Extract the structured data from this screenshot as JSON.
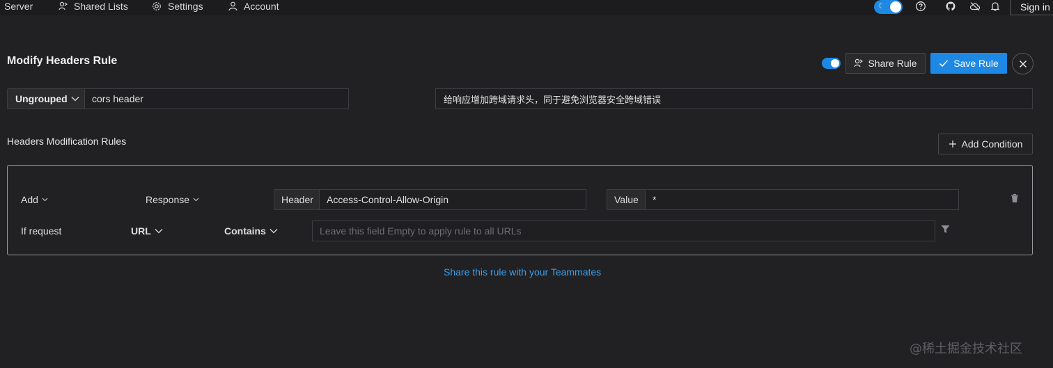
{
  "nav": {
    "server_label": "Server",
    "shared_lists_label": "Shared Lists",
    "settings_label": "Settings",
    "account_label": "Account",
    "sign_in_label": "Sign in"
  },
  "header": {
    "title": "Modify Headers Rule",
    "share_rule_label": "Share Rule",
    "save_rule_label": "Save Rule",
    "rule_enabled": true
  },
  "rule_meta": {
    "group": "Ungrouped",
    "name": "cors header",
    "description": "给响应增加跨域请求头，同于避免浏览器安全跨域错误"
  },
  "section": {
    "title": "Headers Modification Rules",
    "add_condition_label": "Add Condition"
  },
  "modification": {
    "action": "Add",
    "target": "Response",
    "header_addon": "Header",
    "header_value": "Access-Control-Allow-Origin",
    "value_addon": "Value",
    "value": "*"
  },
  "condition": {
    "label": "If request",
    "source": "URL",
    "operator": "Contains",
    "url_placeholder": "Leave this field Empty to apply rule to all URLs"
  },
  "footer": {
    "share_link": "Share this rule with your Teammates",
    "watermark": "@稀土掘金技术社区"
  },
  "colors": {
    "accent": "#1e88e5",
    "background": "#212124",
    "link": "#3b9eea"
  }
}
